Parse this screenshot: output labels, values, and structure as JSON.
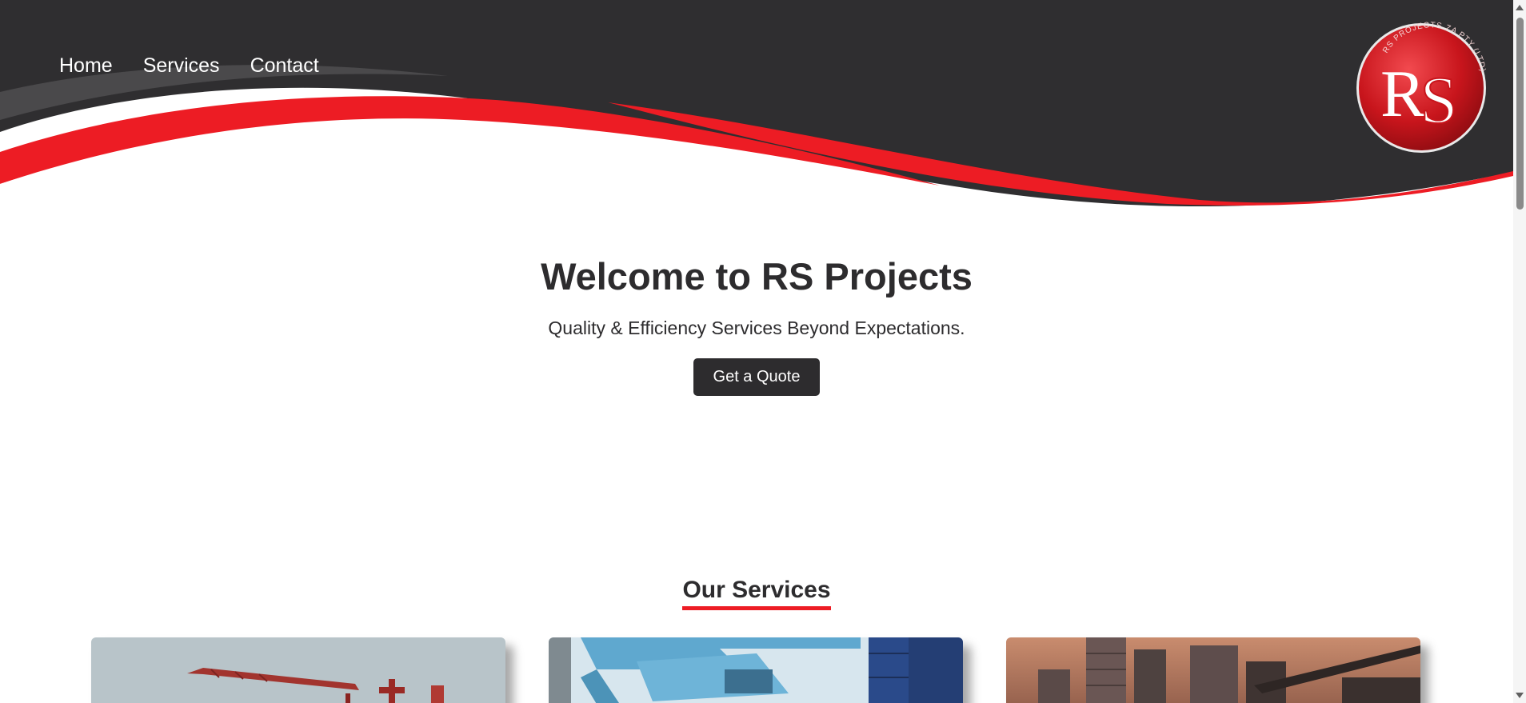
{
  "nav": {
    "items": [
      {
        "label": "Home"
      },
      {
        "label": "Services"
      },
      {
        "label": "Contact"
      }
    ]
  },
  "logo": {
    "letters": "RS",
    "ring_text": "RS PROJECTS ZA PTY (LTD)"
  },
  "hero": {
    "title": "Welcome to RS Projects",
    "subtitle": "Quality & Efficiency Services Beyond Expectations.",
    "cta_label": "Get a Quote"
  },
  "services": {
    "heading": "Our Services",
    "cards": [
      {
        "image": "crane-construction-photo"
      },
      {
        "image": "port-container-crane-photo"
      },
      {
        "image": "city-skyline-photo"
      }
    ]
  },
  "colors": {
    "dark": "#2d2c2e",
    "accent_red": "#ed1c24",
    "background": "#ffffff"
  }
}
